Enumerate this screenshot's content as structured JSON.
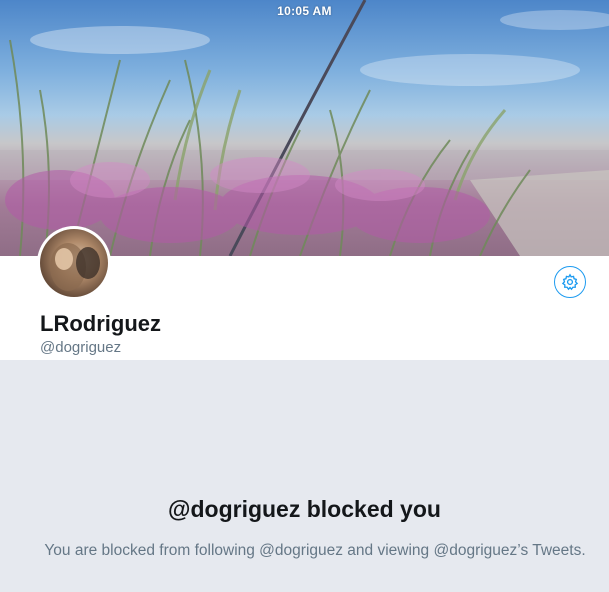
{
  "status_bar": {
    "time": "10:05 AM"
  },
  "profile": {
    "display_name": "LRodriguez",
    "handle": "@dogriguez",
    "settings_icon": "gear-icon"
  },
  "blocked": {
    "title": "@dogriguez blocked you",
    "message": "You are blocked from following @dogriguez and viewing @dogriguez’s Tweets."
  },
  "colors": {
    "accent": "#1d9bf0",
    "name_text": "#14171a",
    "secondary_text": "#657786",
    "blocked_background": "#e6e9ef"
  }
}
